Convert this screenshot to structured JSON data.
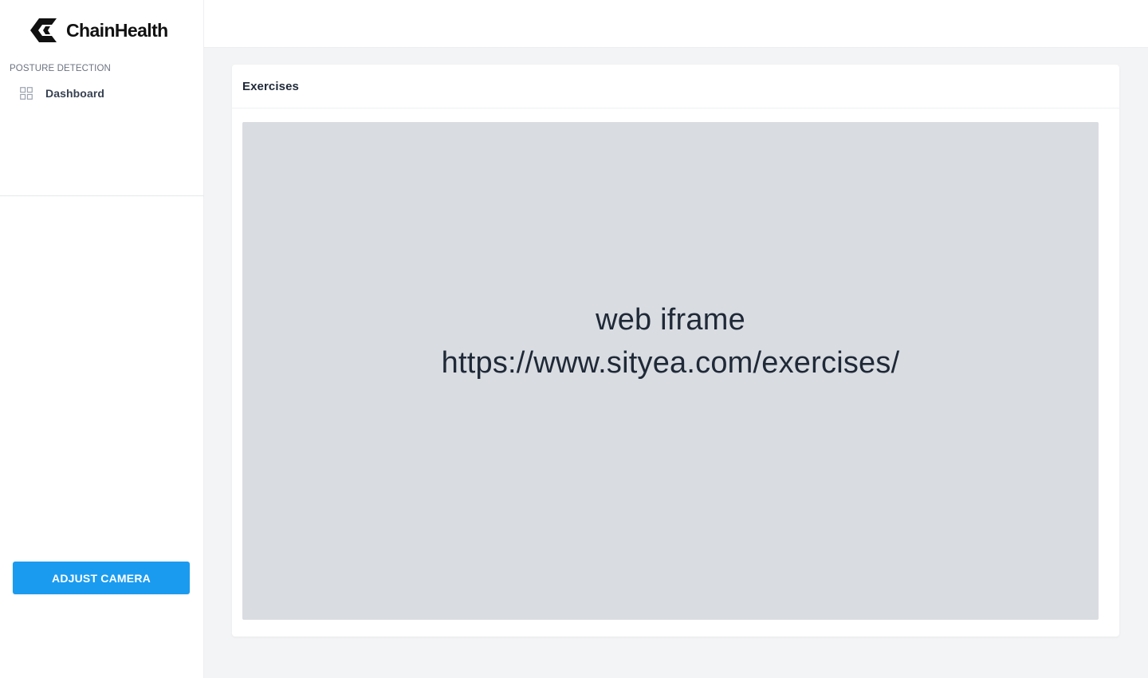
{
  "brand": {
    "name": "ChainHealth",
    "logo_icon": "chain-c-logo"
  },
  "sidebar": {
    "section_label": "POSTURE DETECTION",
    "items": [
      {
        "label": "Dashboard",
        "icon": "grid-icon"
      }
    ],
    "adjust_camera_label": "ADJUST CAMERA"
  },
  "card": {
    "title": "Exercises",
    "iframe": {
      "line1": "web iframe",
      "line2": "https://www.sityea.com/exercises/"
    }
  },
  "colors": {
    "accent": "#1a9bf0",
    "background": "#f3f4f6",
    "iframe_placeholder": "#d9dce1"
  }
}
